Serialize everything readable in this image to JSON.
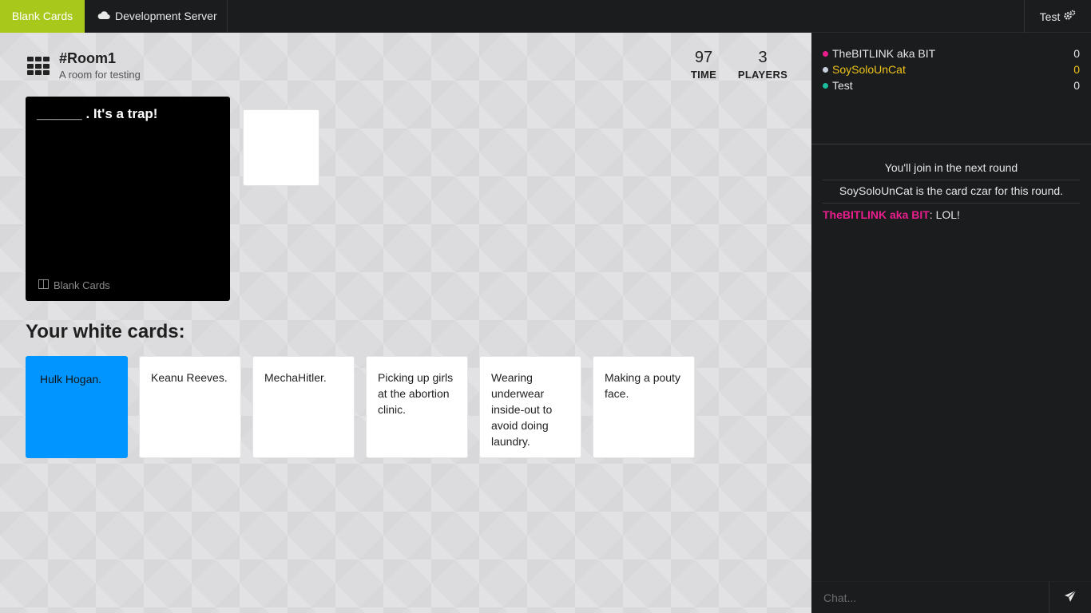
{
  "topbar": {
    "brand": "Blank Cards",
    "server": "Development Server",
    "server_icon": "cloud-icon",
    "user": "Test",
    "user_icon": "gears-icon"
  },
  "room": {
    "name": "#Room1",
    "description": "A room for testing",
    "icon": "grid-icon"
  },
  "stats": {
    "time_value": "97",
    "time_label": "TIME",
    "players_value": "3",
    "players_label": "PLAYERS"
  },
  "black_card": {
    "text": "______ . It's a trap!",
    "deck": "Blank Cards",
    "deck_icon": "book-icon"
  },
  "hand": {
    "title": "Your white cards:",
    "cards": [
      {
        "text": "Hulk Hogan.",
        "selected": true
      },
      {
        "text": "Keanu Reeves.",
        "selected": false
      },
      {
        "text": "MechaHitler.",
        "selected": false
      },
      {
        "text": "Picking up girls at the abortion clinic.",
        "selected": false
      },
      {
        "text": "Wearing underwear inside-out to avoid doing laundry.",
        "selected": false
      },
      {
        "text": "Making a pouty face.",
        "selected": false
      }
    ]
  },
  "players": [
    {
      "name": "TheBITLINK aka BIT",
      "score": "0",
      "dot_color": "#e91e8c",
      "name_color": "#e6e6e6"
    },
    {
      "name": "SoySoloUnCat",
      "score": "0",
      "dot_color": "#c5d0dc",
      "name_color": "#f0c419"
    },
    {
      "name": "Test",
      "score": "0",
      "dot_color": "#1abc9c",
      "name_color": "#e6e6e6"
    }
  ],
  "log": {
    "system": [
      "You'll join in the next round",
      "SoySoloUnCat is the card czar for this round."
    ],
    "chat": [
      {
        "author": "TheBITLINK aka BIT",
        "author_color": "#e91e8c",
        "text": "LOL!"
      }
    ]
  },
  "chat": {
    "placeholder": "Chat...",
    "send_icon": "paper-plane-icon"
  },
  "colors": {
    "brand": "#a8c81c",
    "selected_card": "#0095ff",
    "sidebar_bg": "#1b1c1e",
    "main_bg": "#dcdcde"
  }
}
